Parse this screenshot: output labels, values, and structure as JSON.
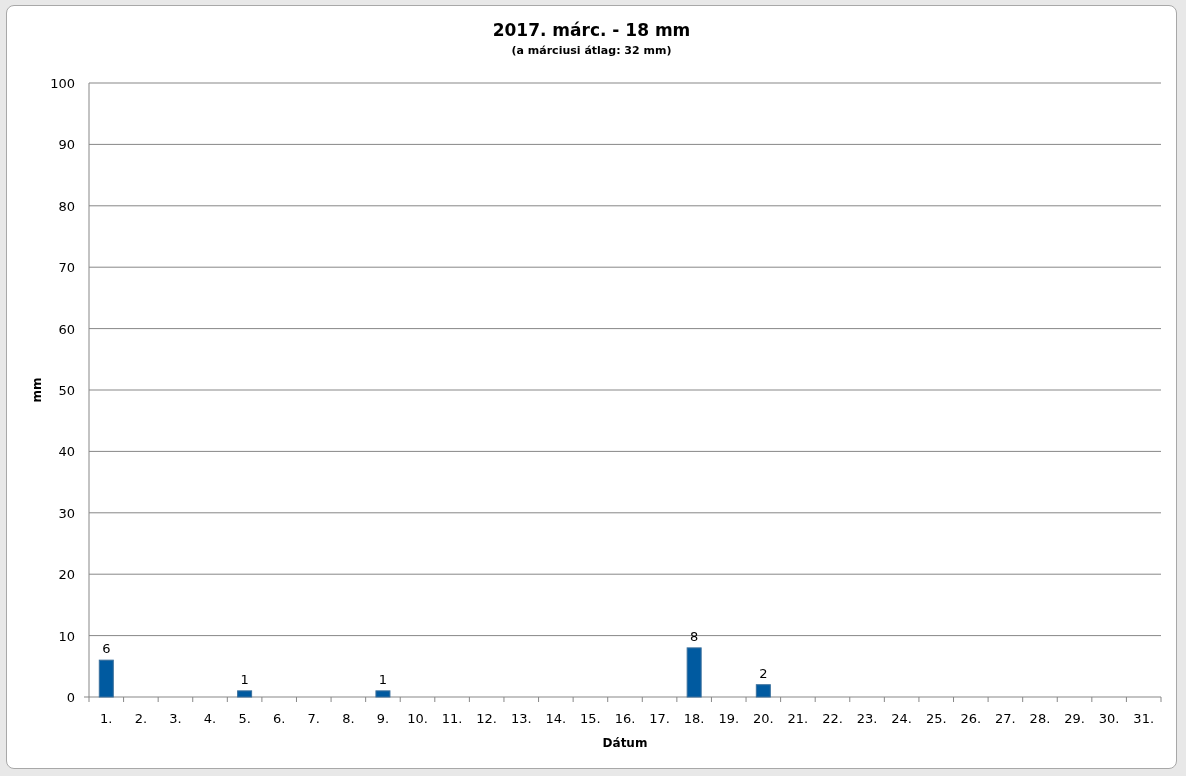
{
  "chart": {
    "subtitle": "(a márciusi átlag: 32 mm)",
    "chart_data": {
      "type": "bar",
      "title": "2017. márc. - 18 mm",
      "xlabel": "Dátum",
      "ylabel": "mm",
      "categories": [
        "1.",
        "2.",
        "3.",
        "4.",
        "5.",
        "6.",
        "7.",
        "8.",
        "9.",
        "10.",
        "11.",
        "12.",
        "13.",
        "14.",
        "15.",
        "16.",
        "17.",
        "18.",
        "19.",
        "20.",
        "21.",
        "22.",
        "23.",
        "24.",
        "25.",
        "26.",
        "27.",
        "28.",
        "29.",
        "30.",
        "31."
      ],
      "series": [
        {
          "color": "#005aa0",
          "values": [
            6,
            null,
            null,
            null,
            1,
            null,
            null,
            null,
            1,
            null,
            null,
            null,
            null,
            null,
            null,
            null,
            null,
            8,
            null,
            2,
            null,
            null,
            null,
            null,
            null,
            null,
            null,
            null,
            null,
            null,
            null
          ]
        }
      ],
      "ylim": [
        0,
        100
      ],
      "yticks": [
        0,
        10,
        20,
        30,
        40,
        50,
        60,
        70,
        80,
        90,
        100
      ],
      "data_labels": true,
      "grid": true
    }
  }
}
